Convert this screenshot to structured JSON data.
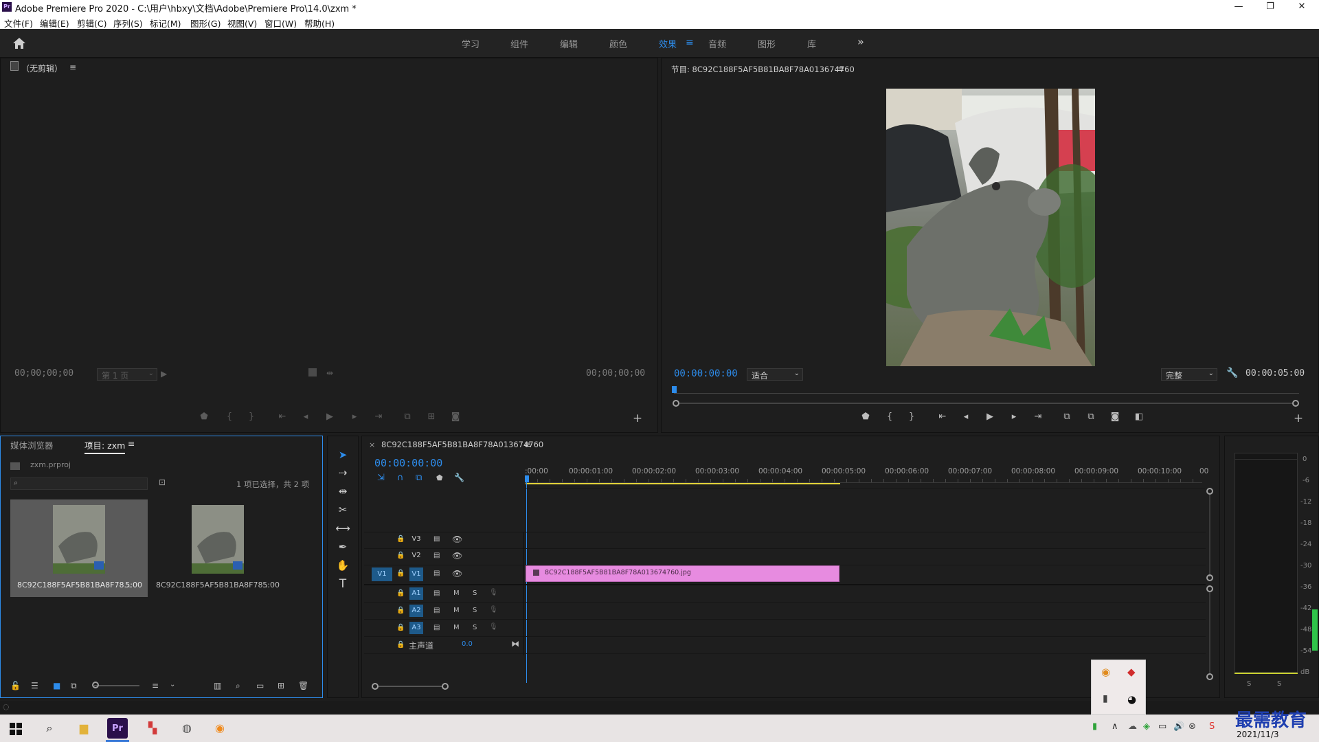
{
  "window": {
    "app_badge": "Pr",
    "title": "Adobe Premiere Pro 2020 - C:\\用户\\hbxy\\文档\\Adobe\\Premiere Pro\\14.0\\zxm *",
    "minimize": "—",
    "maximize": "❐",
    "close": "✕"
  },
  "menu": [
    "文件(F)",
    "编辑(E)",
    "剪辑(C)",
    "序列(S)",
    "标记(M)",
    "图形(G)",
    "视图(V)",
    "窗口(W)",
    "帮助(H)"
  ],
  "workspaces": {
    "items": [
      "学习",
      "组件",
      "编辑",
      "颜色",
      "效果",
      "音频",
      "图形",
      "库"
    ],
    "active": "效果",
    "more": "»"
  },
  "source_monitor": {
    "title": "（无剪辑）",
    "in_tc": "00;00;00;00",
    "page": "第 1 页",
    "out_tc": "00;00;00;00"
  },
  "program_monitor": {
    "title": "节目: 8C92C188F5AF5B81BA8F78A013674760",
    "tc": "00:00:00:00",
    "fit": "适合",
    "quality": "完整",
    "duration": "00:00:05:00"
  },
  "project": {
    "tab_media": "媒体浏览器",
    "tab_project": "项目: zxm",
    "file": "zxm.prproj",
    "selection": "1 项已选择，共 2 项",
    "items": [
      {
        "name": "8C92C188F5AF5B81BA8F78...",
        "dur": "5:00"
      },
      {
        "name": "8C92C188F5AF5B81BA8F78...",
        "dur": "5:00"
      }
    ]
  },
  "timeline": {
    "seq_name": "8C92C188F5AF5B81BA8F78A013674760",
    "tc": "00:00:00:00",
    "ruler": [
      ":00:00",
      "00:00:01:00",
      "00:00:02:00",
      "00:00:03:00",
      "00:00:04:00",
      "00:00:05:00",
      "00:00:06:00",
      "00:00:07:00",
      "00:00:08:00",
      "00:00:09:00",
      "00:00:10:00",
      "00"
    ],
    "tracks": {
      "v3": "V3",
      "v2": "V2",
      "v1": "V1",
      "v1_src": "V1",
      "a1": "A1",
      "a2": "A2",
      "a3": "A3",
      "m": "M",
      "s": "S",
      "master": "主声道",
      "master_val": "0.0"
    },
    "clip": "8C92C188F5AF5B81BA8F78A013674760.jpg",
    "clip_color": "#e78be0"
  },
  "audio_meter": {
    "scale": [
      "0",
      "-6",
      "-12",
      "-18",
      "-24",
      "-30",
      "-36",
      "-42",
      "-48",
      "-54",
      "dB"
    ],
    "solo_l": "S",
    "solo_r": "S"
  },
  "taskbar": {
    "time": "",
    "date": "2021/11/3",
    "watermark": "最需教育"
  }
}
